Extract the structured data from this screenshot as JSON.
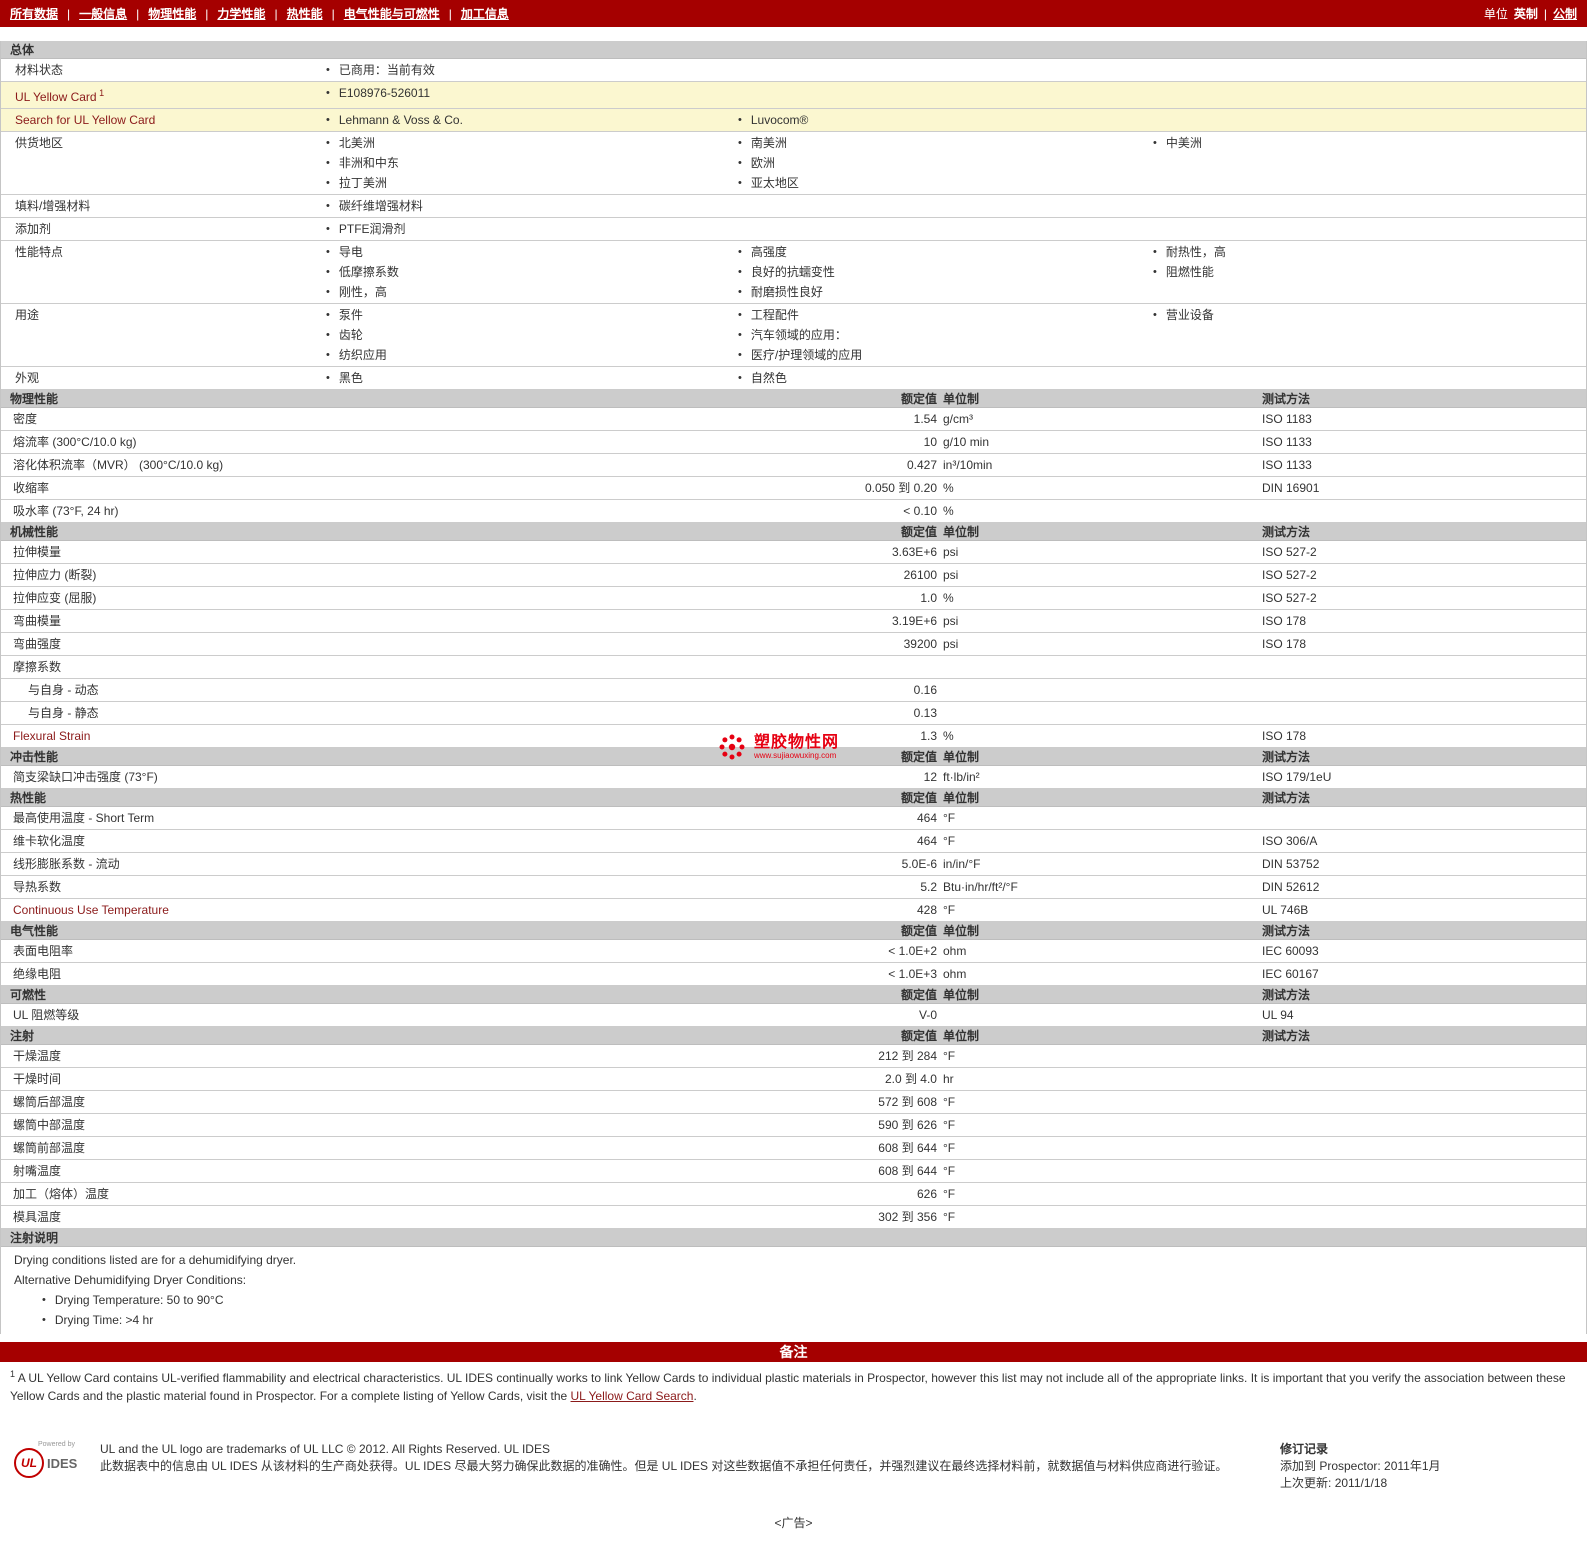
{
  "page": {
    "ad_label": "<广告>"
  },
  "nav": {
    "items": [
      "所有数据",
      "一般信息",
      "物理性能",
      "力学性能",
      "热性能",
      "电气性能与可燃性",
      "加工信息"
    ],
    "active_index": 0,
    "units_label": "单位",
    "unit_english": "英制",
    "unit_metric": "公制"
  },
  "watermark": {
    "name": "塑胶物性网",
    "url": "www.sujiaowuxing.com"
  },
  "column_headers": {
    "value": "额定值",
    "unit": "单位制",
    "method": "测试方法"
  },
  "general": {
    "title": "总体",
    "rows": [
      {
        "label": "材料状态",
        "cols": [
          [
            "已商用：当前有效"
          ],
          [],
          []
        ]
      },
      {
        "label": "UL Yellow Card",
        "sup": "1",
        "accent": true,
        "highlight": true,
        "cols": [
          [
            "E108976-526011"
          ],
          [],
          []
        ]
      },
      {
        "label": "Search for UL Yellow Card",
        "accent": true,
        "link": true,
        "highlight": true,
        "cols": [
          [
            "Lehmann & Voss & Co."
          ],
          [
            "Luvocom®"
          ],
          []
        ]
      },
      {
        "label": "供货地区",
        "cols": [
          [
            "北美洲",
            "非洲和中东",
            "拉丁美洲"
          ],
          [
            "南美洲",
            "欧洲",
            "亚太地区"
          ],
          [
            "中美洲"
          ]
        ]
      },
      {
        "label": "填料/增强材料",
        "cols": [
          [
            "碳纤维增强材料"
          ],
          [],
          []
        ]
      },
      {
        "label": "添加剂",
        "cols": [
          [
            "PTFE润滑剂"
          ],
          [],
          []
        ]
      },
      {
        "label": "性能特点",
        "cols": [
          [
            "导电",
            "低摩擦系数",
            "刚性，高"
          ],
          [
            "高强度",
            "良好的抗蠕变性",
            "耐磨损性良好"
          ],
          [
            "耐热性，高",
            "阻燃性能"
          ]
        ]
      },
      {
        "label": "用途",
        "cols": [
          [
            "泵件",
            "齿轮",
            "纺织应用"
          ],
          [
            "工程配件",
            "汽车领域的应用：",
            "医疗/护理领域的应用"
          ],
          [
            "营业设备"
          ]
        ]
      },
      {
        "label": "外观",
        "cols": [
          [
            "黑色"
          ],
          [
            "自然色"
          ],
          []
        ]
      }
    ]
  },
  "sections": [
    {
      "title": "物理性能",
      "rows": [
        {
          "name": "密度",
          "value": "1.54",
          "unit": "g/cm³",
          "method": "ISO 1183"
        },
        {
          "name": "熔流率  (300°C/10.0 kg)",
          "value": "10",
          "unit": "g/10 min",
          "method": "ISO 1133"
        },
        {
          "name": "溶化体积流率（MVR） (300°C/10.0 kg)",
          "value": "0.427",
          "unit": "in³/10min",
          "method": "ISO 1133"
        },
        {
          "name": "收缩率",
          "value": "0.050 到  0.20",
          "unit": "%",
          "method": "DIN 16901"
        },
        {
          "name": "吸水率  (73°F, 24 hr)",
          "value": "< 0.10",
          "unit": "%",
          "method": ""
        }
      ]
    },
    {
      "title": "机械性能",
      "rows": [
        {
          "name": "拉伸模量",
          "value": "3.63E+6",
          "unit": "psi",
          "method": "ISO 527-2"
        },
        {
          "name": "拉伸应力  (断裂)",
          "value": "26100",
          "unit": "psi",
          "method": "ISO 527-2"
        },
        {
          "name": "拉伸应变  (屈服)",
          "value": "1.0",
          "unit": "%",
          "method": "ISO 527-2"
        },
        {
          "name": "弯曲模量",
          "value": "3.19E+6",
          "unit": "psi",
          "method": "ISO 178"
        },
        {
          "name": "弯曲强度",
          "value": "39200",
          "unit": "psi",
          "method": "ISO 178"
        },
        {
          "name": "摩擦系数",
          "value": "",
          "unit": "",
          "method": ""
        },
        {
          "name": "与自身  - 动态",
          "indent": 1,
          "value": "0.16",
          "unit": "",
          "method": ""
        },
        {
          "name": "与自身  - 静态",
          "indent": 1,
          "value": "0.13",
          "unit": "",
          "method": ""
        },
        {
          "name": "Flexural Strain",
          "accent": true,
          "value": "1.3",
          "unit": "%",
          "method": "ISO 178"
        }
      ]
    },
    {
      "title": "冲击性能",
      "rows": [
        {
          "name": "简支梁缺口冲击强度  (73°F)",
          "value": "12",
          "unit": "ft·lb/in²",
          "method": "ISO 179/1eU"
        }
      ]
    },
    {
      "title": "热性能",
      "rows": [
        {
          "name": "最高使用温度  - Short Term",
          "value": "464",
          "unit": "°F",
          "method": ""
        },
        {
          "name": "维卡软化温度",
          "value": "464",
          "unit": "°F",
          "method": "ISO 306/A"
        },
        {
          "name": "线形膨胀系数  - 流动",
          "value": "5.0E-6",
          "unit": "in/in/°F",
          "method": "DIN 53752"
        },
        {
          "name": "导热系数",
          "value": "5.2",
          "unit": "Btu·in/hr/ft²/°F",
          "method": "DIN 52612"
        },
        {
          "name": "Continuous Use Temperature",
          "accent": true,
          "value": "428",
          "unit": "°F",
          "method": "UL 746B"
        }
      ]
    },
    {
      "title": "电气性能",
      "rows": [
        {
          "name": "表面电阻率",
          "value": "< 1.0E+2",
          "unit": "ohm",
          "method": "IEC 60093"
        },
        {
          "name": "绝缘电阻",
          "value": "< 1.0E+3",
          "unit": "ohm",
          "method": "IEC 60167"
        }
      ]
    },
    {
      "title": "可燃性",
      "rows": [
        {
          "name": "UL 阻燃等级",
          "value": "V-0",
          "unit": "",
          "method": "UL 94"
        }
      ]
    },
    {
      "title": "注射",
      "rows": [
        {
          "name": "干燥温度",
          "value": "212 到  284",
          "unit": "°F",
          "method": ""
        },
        {
          "name": "干燥时间",
          "value": "2.0 到  4.0",
          "unit": "hr",
          "method": ""
        },
        {
          "name": "螺筒后部温度",
          "value": "572 到  608",
          "unit": "°F",
          "method": ""
        },
        {
          "name": "螺筒中部温度",
          "value": "590 到  626",
          "unit": "°F",
          "method": ""
        },
        {
          "name": "螺筒前部温度",
          "value": "608 到  644",
          "unit": "°F",
          "method": ""
        },
        {
          "name": "射嘴温度",
          "value": "608 到  644",
          "unit": "°F",
          "method": ""
        },
        {
          "name": "加工（熔体）温度",
          "value": "626",
          "unit": "°F",
          "method": ""
        },
        {
          "name": "模具温度",
          "value": "302 到  356",
          "unit": "°F",
          "method": ""
        }
      ]
    }
  ],
  "notes_section": {
    "title": "注射说明",
    "lines": [
      "Drying conditions listed are for a dehumidifying dryer.",
      "Alternative Dehumidifying Dryer Conditions:"
    ],
    "bullets": [
      "Drying Temperature: 50 to 90°C",
      "Drying Time: >4 hr"
    ]
  },
  "remarks": {
    "title": "备注",
    "footnote_sup": "1",
    "text": " A UL Yellow Card contains UL-verified flammability and electrical characteristics. UL IDES continually works to link Yellow Cards to individual plastic materials in Prospector, however this list may not include all of the appropriate links. It is important that you verify the association between these Yellow Cards and the plastic material found in Prospector. For a complete listing of Yellow Cards, visit the ",
    "link_text": "UL Yellow Card Search",
    "text_after": "."
  },
  "footer": {
    "logo_powered": "Powered by",
    "logo_ul": "UL",
    "logo_ides": "IDES",
    "trademark_en": "UL and the UL logo are trademarks of UL LLC © 2012. All Rights Reserved. UL IDES",
    "disclaimer_zh": "此数据表中的信息由  UL IDES  从该材料的生产商处获得。UL IDES 尽最大努力确保此数据的准确性。但是  UL IDES  对这些数据值不承担任何责任，并强烈建议在最终选择材料前，就数据值与材料供应商进行验证。",
    "revision_title": "修订记录",
    "added_label": "添加到  Prospector:",
    "added_value": "2011年1月",
    "updated_label": "上次更新:",
    "updated_value": "2011/1/18"
  }
}
